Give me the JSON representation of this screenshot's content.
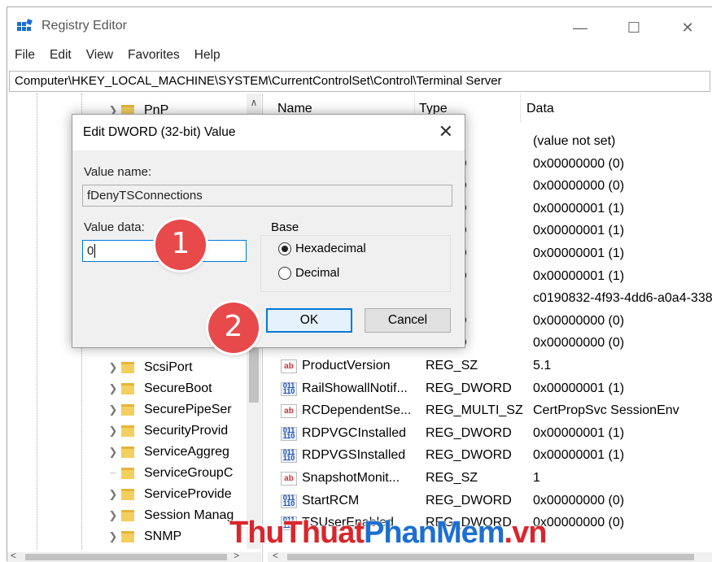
{
  "window": {
    "title": "Registry Editor",
    "controls": {
      "minimize": "—",
      "maximize": "☐",
      "close": "✕"
    }
  },
  "menu": [
    "File",
    "Edit",
    "View",
    "Favorites",
    "Help"
  ],
  "address": "Computer\\HKEY_LOCAL_MACHINE\\SYSTEM\\CurrentControlSet\\Control\\Terminal Server",
  "tree": {
    "items": [
      {
        "label": "PnP"
      },
      {
        "label": "ScsiPort"
      },
      {
        "label": "SecureBoot"
      },
      {
        "label": "SecurePipeSer"
      },
      {
        "label": "SecurityProvid"
      },
      {
        "label": "ServiceAggreg"
      },
      {
        "label": "ServiceGroupC"
      },
      {
        "label": "ServiceProvide"
      },
      {
        "label": "Session Manag"
      },
      {
        "label": "SNMP"
      }
    ]
  },
  "list": {
    "columns": [
      "Name",
      "Type",
      "Data"
    ],
    "rows": [
      {
        "name": "",
        "type": "",
        "data": "(value not set)"
      },
      {
        "name": "",
        "type": "WORD",
        "data": "0x00000000 (0)"
      },
      {
        "name": "",
        "type": "WORD",
        "data": "0x00000000 (0)"
      },
      {
        "name": "",
        "type": "WORD",
        "data": "0x00000001 (1)"
      },
      {
        "name": "",
        "type": "WORD",
        "data": "0x00000001 (1)"
      },
      {
        "name": "",
        "type": "WORD",
        "data": "0x00000001 (1)"
      },
      {
        "name": "",
        "type": "WORD",
        "data": "0x00000001 (1)"
      },
      {
        "name": "",
        "type": "",
        "data": "c0190832-4f93-4dd6-a0a4-338"
      },
      {
        "name": "",
        "type": "WORD",
        "data": "0x00000000 (0)"
      },
      {
        "name": "",
        "type": "WORD",
        "data": "0x00000000 (0)"
      },
      {
        "name": "ProductVersion",
        "type": "REG_SZ",
        "data": "5.1",
        "icon": "ab"
      },
      {
        "name": "RailShowallNotif...",
        "type": "REG_DWORD",
        "data": "0x00000001 (1)",
        "icon": "bin"
      },
      {
        "name": "RCDependentSe...",
        "type": "REG_MULTI_SZ",
        "data": "CertPropSvc SessionEnv",
        "icon": "ab"
      },
      {
        "name": "RDPVGCInstalled",
        "type": "REG_DWORD",
        "data": "0x00000001 (1)",
        "icon": "bin"
      },
      {
        "name": "RDPVGSInstalled",
        "type": "REG_DWORD",
        "data": "0x00000001 (1)",
        "icon": "bin"
      },
      {
        "name": "SnapshotMonit...",
        "type": "REG_SZ",
        "data": "1",
        "icon": "ab"
      },
      {
        "name": "StartRCM",
        "type": "REG_DWORD",
        "data": "0x00000000 (0)",
        "icon": "bin"
      },
      {
        "name": "TSUserEnabled",
        "type": "REG_DWORD",
        "data": "0x00000000 (0)",
        "icon": "bin"
      }
    ]
  },
  "dialog": {
    "title": "Edit DWORD (32-bit) Value",
    "close": "✕",
    "value_name_label": "Value name:",
    "value_name": "fDenyTSConnections",
    "value_data_label": "Value data:",
    "value_data": "0",
    "base_label": "Base",
    "hex_label": "Hexadecimal",
    "dec_label": "Decimal",
    "ok_label": "OK",
    "cancel_label": "Cancel"
  },
  "annotations": {
    "step1": "1",
    "step2": "2"
  },
  "watermark": {
    "part1": "ThuThuat",
    "part2": "PhanMem",
    "part3": ".vn",
    "color1": "#d9262c",
    "color2": "#1d6fd1",
    "color3": "#d9262c"
  },
  "icon_ab": "ab",
  "icon_bin": "011\n110",
  "colors": {
    "accent": "#0078d7",
    "badge": "#e8494b"
  }
}
